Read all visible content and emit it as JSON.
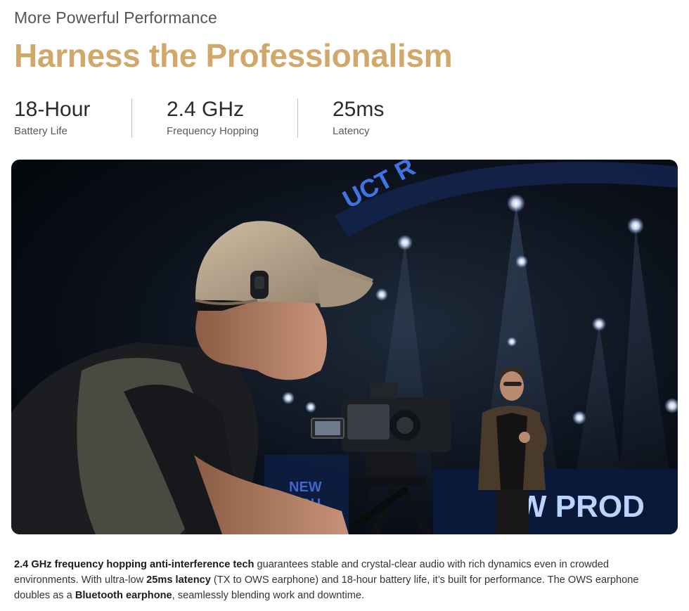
{
  "header": {
    "eyebrow": "More Powerful Performance",
    "headline": "Harness the Professionalism"
  },
  "stats": [
    {
      "value": "18-Hour",
      "label": "Battery Life"
    },
    {
      "value": "2.4 GHz",
      "label": "Frequency Hopping"
    },
    {
      "value": "25ms",
      "label": "Latency"
    }
  ],
  "hero": {
    "stage_sign_top": "UCT R",
    "stage_sign_left_1": "NEW",
    "stage_sign_left_2": "PRODU",
    "stage_sign_right": "W PROD"
  },
  "description": {
    "b1": "2.4 GHz frequency hopping anti-interference tech",
    "t1": " guarantees stable and crystal-clear audio with rich dynamics even in crowded environments. With ultra-low ",
    "b2": "25ms latency",
    "t2": " (TX to OWS earphone) and 18-hour battery life, it’s built for performance. The OWS earphone doubles as a ",
    "b3": "Bluetooth earphone",
    "t3": ", seamlessly blending work and downtime."
  },
  "colors": {
    "accent_gold": "#d0a86a",
    "stage_blue": "#2f5fd8"
  }
}
